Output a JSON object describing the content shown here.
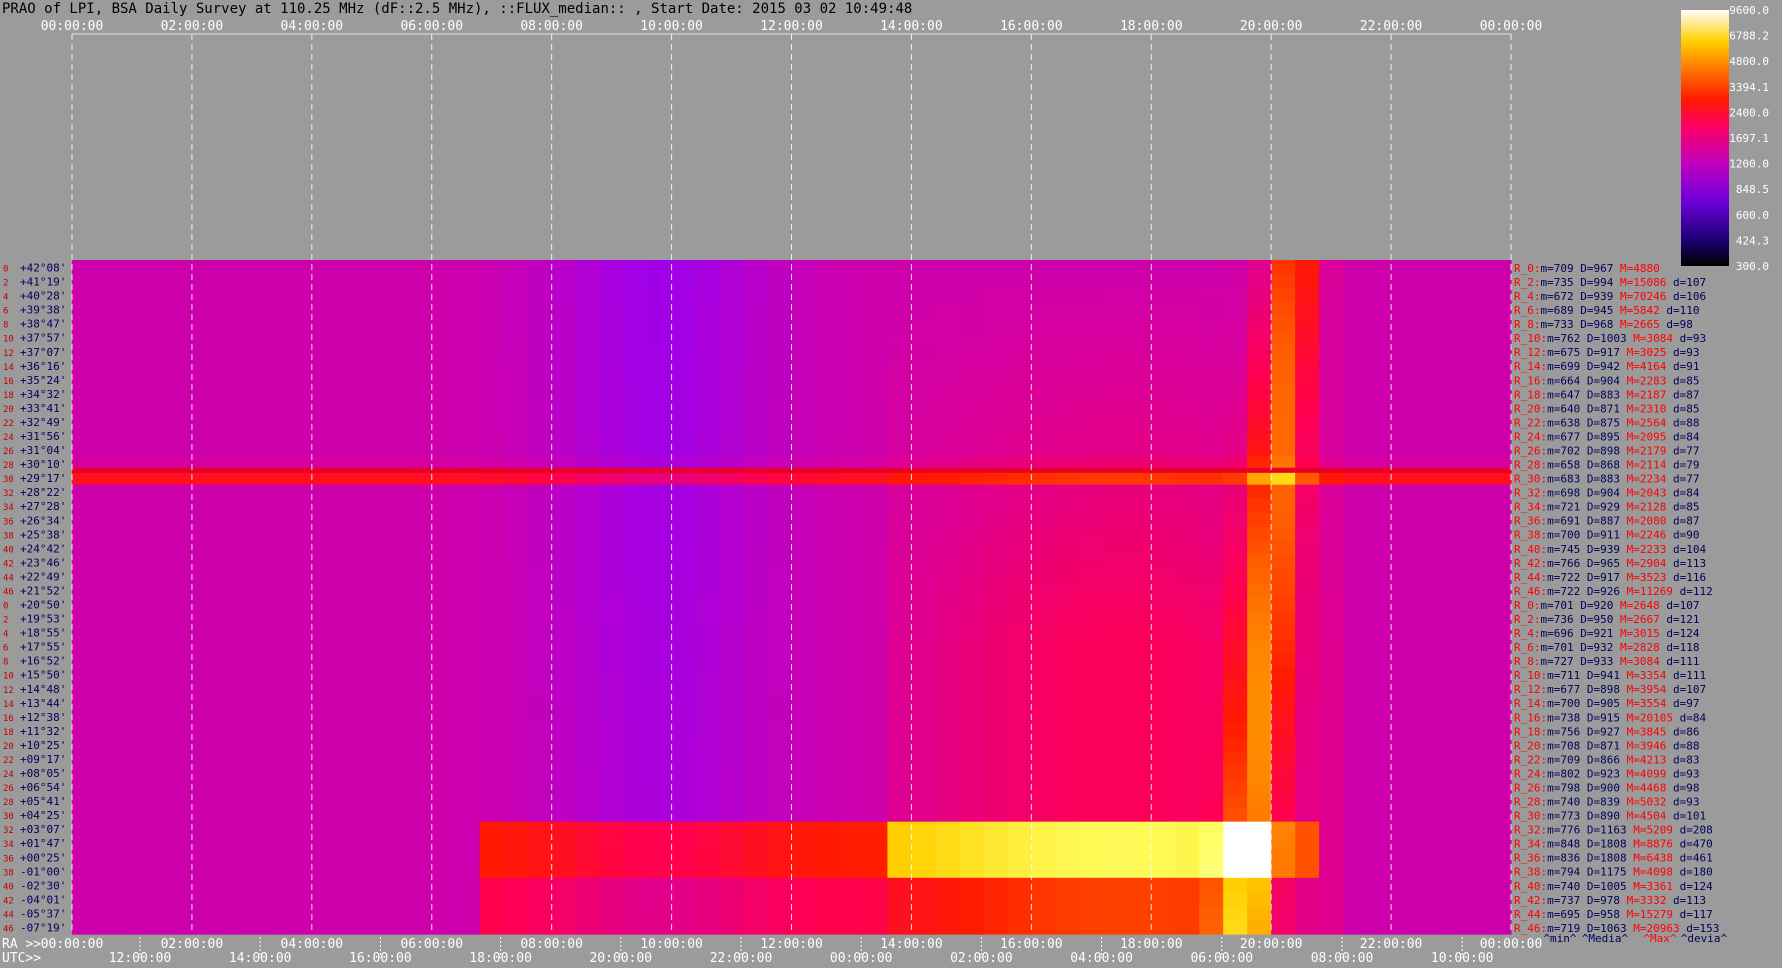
{
  "title": "PRAO of LPI, BSA Daily Survey at 110.25 MHz (dF::2.5 MHz), ::FLUX_median:: , Start Date: 2015 03 02 10:49:48",
  "chart_data": {
    "type": "heatmap",
    "title": "PRAO of LPI, BSA Daily Survey at 110.25 MHz (dF::2.5 MHz), ::FLUX_median:: , Start Date: 2015 03 02 10:49:48",
    "top_axis_ticks": [
      "00:00:00",
      "02:00:00",
      "04:00:00",
      "06:00:00",
      "08:00:00",
      "10:00:00",
      "12:00:00",
      "14:00:00",
      "16:00:00",
      "18:00:00",
      "20:00:00",
      "22:00:00",
      "00:00:00"
    ],
    "ra_axis_label": "RA >>",
    "ra_ticks": [
      "00:00:00",
      "02:00:00",
      "04:00:00",
      "06:00:00",
      "08:00:00",
      "10:00:00",
      "12:00:00",
      "14:00:00",
      "16:00:00",
      "18:00:00",
      "20:00:00",
      "22:00:00",
      "00:00:00"
    ],
    "utc_axis_label": "UTC>>",
    "utc_ticks": [
      "12:00:00",
      "14:00:00",
      "16:00:00",
      "18:00:00",
      "20:00:00",
      "22:00:00",
      "00:00:00",
      "02:00:00",
      "04:00:00",
      "06:00:00",
      "08:00:00",
      "10:00:00"
    ],
    "declinations": [
      "+42°08'",
      "+41°19'",
      "+40°28'",
      "+39°38'",
      "+38°47'",
      "+37°57'",
      "+37°07'",
      "+36°16'",
      "+35°24'",
      "+34°32'",
      "+33°41'",
      "+32°49'",
      "+31°56'",
      "+31°04'",
      "+30°10'",
      "+29°17'",
      "+28°22'",
      "+27°28'",
      "+26°34'",
      "+25°38'",
      "+24°42'",
      "+23°46'",
      "+22°49'",
      "+21°52'",
      "+20°50'",
      "+19°53'",
      "+18°55'",
      "+17°55'",
      "+16°52'",
      "+15°50'",
      "+14°48'",
      "+13°44'",
      "+12°38'",
      "+11°32'",
      "+10°25'",
      "+09°17'",
      "+08°05'",
      "+06°54'",
      "+05°41'",
      "+04°25'",
      "+03°07'",
      "+01°47'",
      "+00°25'",
      "-01°00'",
      "-02°30'",
      "-04°01'",
      "-05°37'",
      "-07°19'"
    ],
    "beam_numbers": [
      "0",
      "2",
      "4",
      "6",
      "8",
      "10",
      "12",
      "14",
      "16",
      "18",
      "20",
      "22",
      "24",
      "26",
      "28",
      "30",
      "32",
      "34",
      "36",
      "38",
      "40",
      "42",
      "44",
      "46",
      "0",
      "2",
      "4",
      "6",
      "8",
      "10",
      "12",
      "14",
      "16",
      "18",
      "20",
      "22",
      "24",
      "26",
      "28",
      "30",
      "32",
      "34",
      "36",
      "38",
      "40",
      "42",
      "44",
      "46"
    ],
    "colorbar": {
      "min": 300.0,
      "max": 9600.0,
      "labels": [
        "9600.0",
        "6788.2",
        "4800.0",
        "3394.1",
        "2400.0",
        "1697.1",
        "1200.0",
        "848.5",
        "600.0",
        "424.3",
        "300.0"
      ]
    },
    "stats": [
      {
        "beam": "R_0:",
        "m": "709",
        "D": "967",
        "M": "4880",
        "d": ""
      },
      {
        "beam": "R_2:",
        "m": "735",
        "D": "994",
        "M": "15086",
        "d": "107"
      },
      {
        "beam": "R_4:",
        "m": "672",
        "D": "939",
        "M": "70246",
        "d": "106"
      },
      {
        "beam": "R_6:",
        "m": "689",
        "D": "945",
        "M": "5842",
        "d": "110"
      },
      {
        "beam": "R_8:",
        "m": "733",
        "D": "968",
        "M": "2665",
        "d": "98"
      },
      {
        "beam": "R_10:",
        "m": "762",
        "D": "1003",
        "M": "3084",
        "d": "93"
      },
      {
        "beam": "R_12:",
        "m": "675",
        "D": "917",
        "M": "3025",
        "d": "93"
      },
      {
        "beam": "R_14:",
        "m": "699",
        "D": "942",
        "M": "4164",
        "d": "91"
      },
      {
        "beam": "R_16:",
        "m": "664",
        "D": "904",
        "M": "2283",
        "d": "85"
      },
      {
        "beam": "R_18:",
        "m": "647",
        "D": "883",
        "M": "2187",
        "d": "87"
      },
      {
        "beam": "R_20:",
        "m": "640",
        "D": "871",
        "M": "2310",
        "d": "85"
      },
      {
        "beam": "R_22:",
        "m": "638",
        "D": "875",
        "M": "2564",
        "d": "88"
      },
      {
        "beam": "R_24:",
        "m": "677",
        "D": "895",
        "M": "2095",
        "d": "84"
      },
      {
        "beam": "R_26:",
        "m": "702",
        "D": "898",
        "M": "2179",
        "d": "77"
      },
      {
        "beam": "R_28:",
        "m": "658",
        "D": "868",
        "M": "2114",
        "d": "79"
      },
      {
        "beam": "R_30:",
        "m": "683",
        "D": "883",
        "M": "2234",
        "d": "77"
      },
      {
        "beam": "R_32:",
        "m": "698",
        "D": "904",
        "M": "2043",
        "d": "84"
      },
      {
        "beam": "R_34:",
        "m": "721",
        "D": "929",
        "M": "2128",
        "d": "85"
      },
      {
        "beam": "R_36:",
        "m": "691",
        "D": "887",
        "M": "2080",
        "d": "87"
      },
      {
        "beam": "R_38:",
        "m": "700",
        "D": "911",
        "M": "2246",
        "d": "90"
      },
      {
        "beam": "R_40:",
        "m": "745",
        "D": "939",
        "M": "2233",
        "d": "104"
      },
      {
        "beam": "R_42:",
        "m": "766",
        "D": "965",
        "M": "2904",
        "d": "113"
      },
      {
        "beam": "R_44:",
        "m": "722",
        "D": "917",
        "M": "3523",
        "d": "116"
      },
      {
        "beam": "R_46:",
        "m": "722",
        "D": "926",
        "M": "11269",
        "d": "112"
      },
      {
        "beam": "R_0:",
        "m": "701",
        "D": "920",
        "M": "2648",
        "d": "107"
      },
      {
        "beam": "R_2:",
        "m": "736",
        "D": "950",
        "M": "2667",
        "d": "121"
      },
      {
        "beam": "R_4:",
        "m": "696",
        "D": "921",
        "M": "3015",
        "d": "124"
      },
      {
        "beam": "R_6:",
        "m": "701",
        "D": "932",
        "M": "2828",
        "d": "118"
      },
      {
        "beam": "R_8:",
        "m": "727",
        "D": "933",
        "M": "3084",
        "d": "111"
      },
      {
        "beam": "R_10:",
        "m": "711",
        "D": "941",
        "M": "3354",
        "d": "111"
      },
      {
        "beam": "R_12:",
        "m": "677",
        "D": "898",
        "M": "3954",
        "d": "107"
      },
      {
        "beam": "R_14:",
        "m": "700",
        "D": "905",
        "M": "3554",
        "d": "97"
      },
      {
        "beam": "R_16:",
        "m": "738",
        "D": "915",
        "M": "20105",
        "d": "84"
      },
      {
        "beam": "R_18:",
        "m": "756",
        "D": "927",
        "M": "3845",
        "d": "86"
      },
      {
        "beam": "R_20:",
        "m": "708",
        "D": "871",
        "M": "3946",
        "d": "88"
      },
      {
        "beam": "R_22:",
        "m": "709",
        "D": "866",
        "M": "4213",
        "d": "83"
      },
      {
        "beam": "R_24:",
        "m": "802",
        "D": "923",
        "M": "4099",
        "d": "93"
      },
      {
        "beam": "R_26:",
        "m": "798",
        "D": "900",
        "M": "4468",
        "d": "98"
      },
      {
        "beam": "R_28:",
        "m": "740",
        "D": "839",
        "M": "5032",
        "d": "93"
      },
      {
        "beam": "R_30:",
        "m": "773",
        "D": "890",
        "M": "4504",
        "d": "101"
      },
      {
        "beam": "R_32:",
        "m": "776",
        "D": "1163",
        "M": "5209",
        "d": "208"
      },
      {
        "beam": "R_34:",
        "m": "848",
        "D": "1808",
        "M": "8876",
        "d": "470"
      },
      {
        "beam": "R_36:",
        "m": "836",
        "D": "1808",
        "M": "6438",
        "d": "461"
      },
      {
        "beam": "R_38:",
        "m": "794",
        "D": "1175",
        "M": "4098",
        "d": "180"
      },
      {
        "beam": "R_40:",
        "m": "740",
        "D": "1005",
        "M": "3361",
        "d": "124"
      },
      {
        "beam": "R_42:",
        "m": "737",
        "D": "978",
        "M": "3332",
        "d": "113"
      },
      {
        "beam": "R_44:",
        "m": "695",
        "D": "958",
        "M": "15279",
        "d": "117"
      },
      {
        "beam": "R_46:",
        "m": "719",
        "D": "1063",
        "M": "20963",
        "d": "153"
      }
    ],
    "stats_footer": [
      "^min^",
      "^Media^",
      "^Max^",
      "^devia^"
    ],
    "stat_labels": {
      "m": "m=",
      "D": "D=",
      "M": "M=",
      "d": "d="
    },
    "colors": {
      "label_blue": "#00005a",
      "label_red": "#ff0000",
      "beam_num_red": "#c00000"
    }
  }
}
